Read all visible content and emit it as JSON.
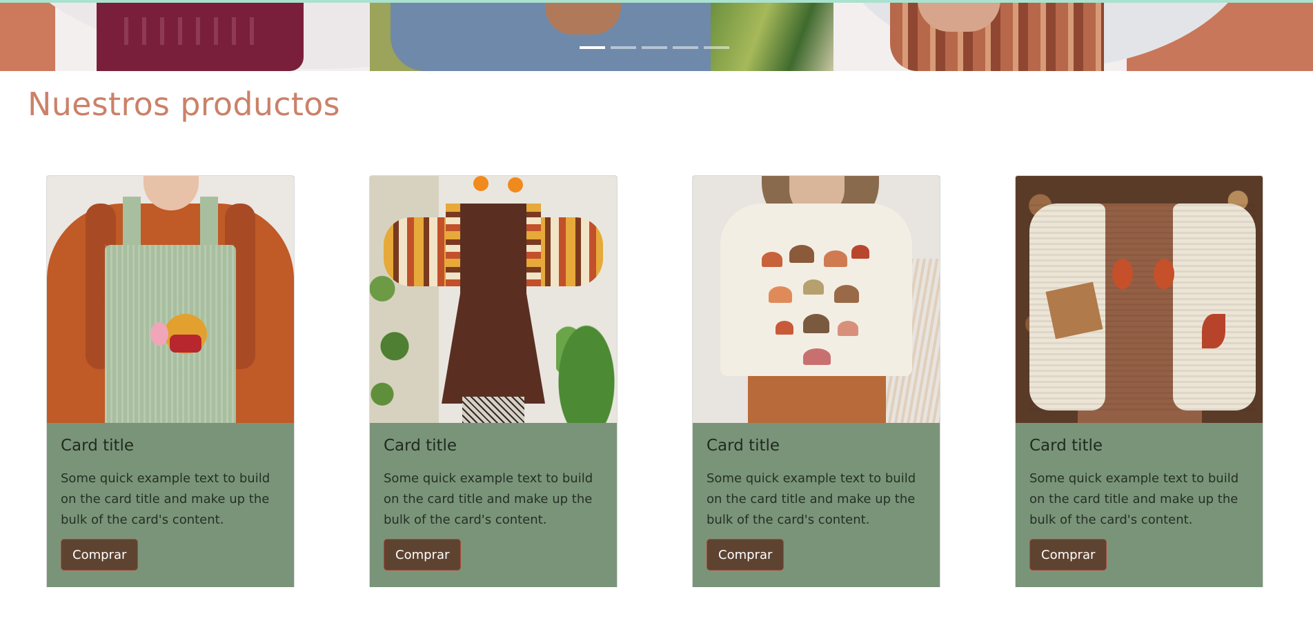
{
  "hero": {
    "indicator_count": 5,
    "active_index": 0
  },
  "section": {
    "title": "Nuestros productos"
  },
  "cards": [
    {
      "title": "Card title",
      "text": "Some quick example text to build on the card title and make up the bulk of the card's content.",
      "button": "Comprar"
    },
    {
      "title": "Card title",
      "text": "Some quick example text to build on the card title and make up the bulk of the card's content.",
      "button": "Comprar"
    },
    {
      "title": "Card title",
      "text": "Some quick example text to build on the card title and make up the bulk of the card's content.",
      "button": "Comprar"
    },
    {
      "title": "Card title",
      "text": "Some quick example text to build on the card title and make up the bulk of the card's content.",
      "button": "Comprar"
    }
  ],
  "colors": {
    "title": "#cb8168",
    "card_body": "#7a9479",
    "button_bg": "#5e4331",
    "button_border": "#b24a3a",
    "top_accent": "#a9e2cf"
  }
}
